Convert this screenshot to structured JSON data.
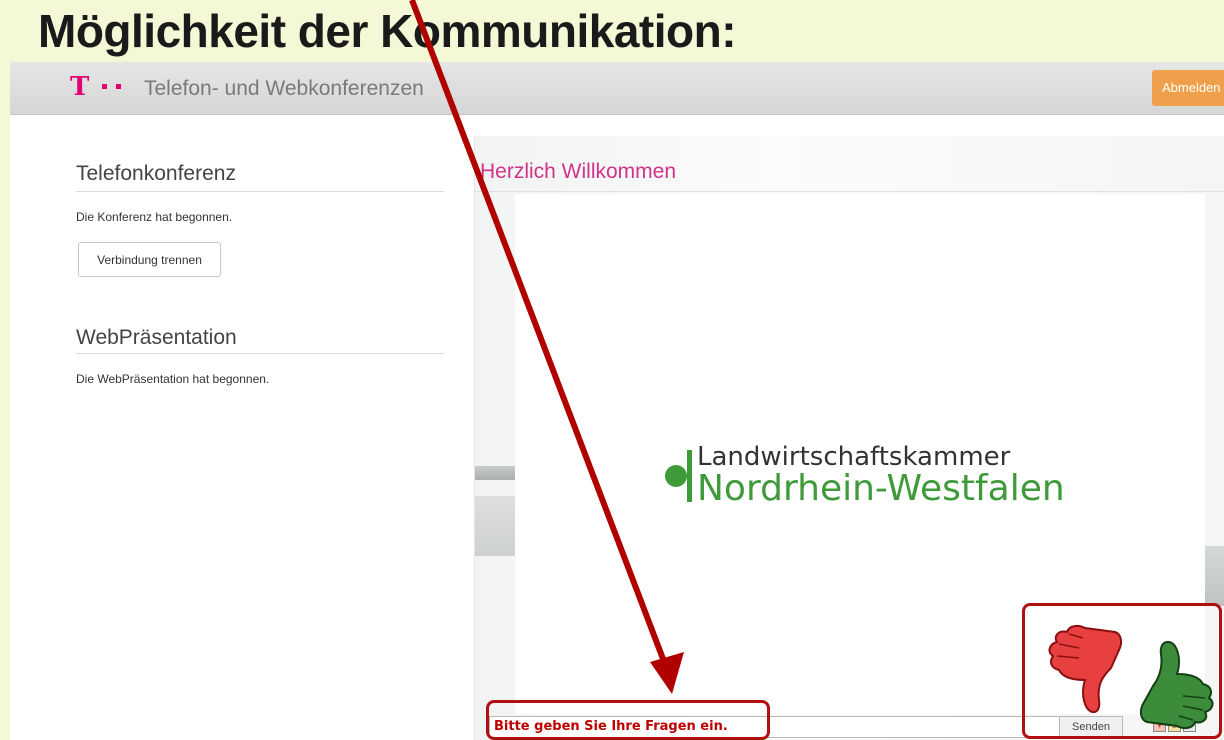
{
  "slide": {
    "title": "Möglichkeit der Kommunikation:"
  },
  "header": {
    "logo": "T",
    "app_title": "Telefon- und Webkonferenzen",
    "logout_label": "Abmelden"
  },
  "sidebar": {
    "phone": {
      "title": "Telefonkonferenz",
      "status": "Die Konferenz hat begonnen.",
      "disconnect_label": "Verbindung trennen"
    },
    "web": {
      "title": "WebPräsentation",
      "status": "Die WebPräsentation hat begonnen."
    }
  },
  "main": {
    "welcome": "Herzlich Willkommen",
    "logo_line1": "Landwirtschaftskammer",
    "logo_line2": "Nordrhein-Westfalen",
    "chat_input_value": "Bitte geben Sie Ihre Fragen ein.",
    "send_label": "Senden"
  },
  "colors": {
    "telekom_magenta": "#e20074",
    "logout_orange": "#f0a04a",
    "lwk_green": "#3f9a3a",
    "highlight_red": "#b01010",
    "thumb_down": "#e83c3c",
    "thumb_up": "#3c8c3c"
  },
  "icons": [
    "thumbs-down-icon",
    "thumbs-up-icon",
    "arrow-annotation"
  ]
}
